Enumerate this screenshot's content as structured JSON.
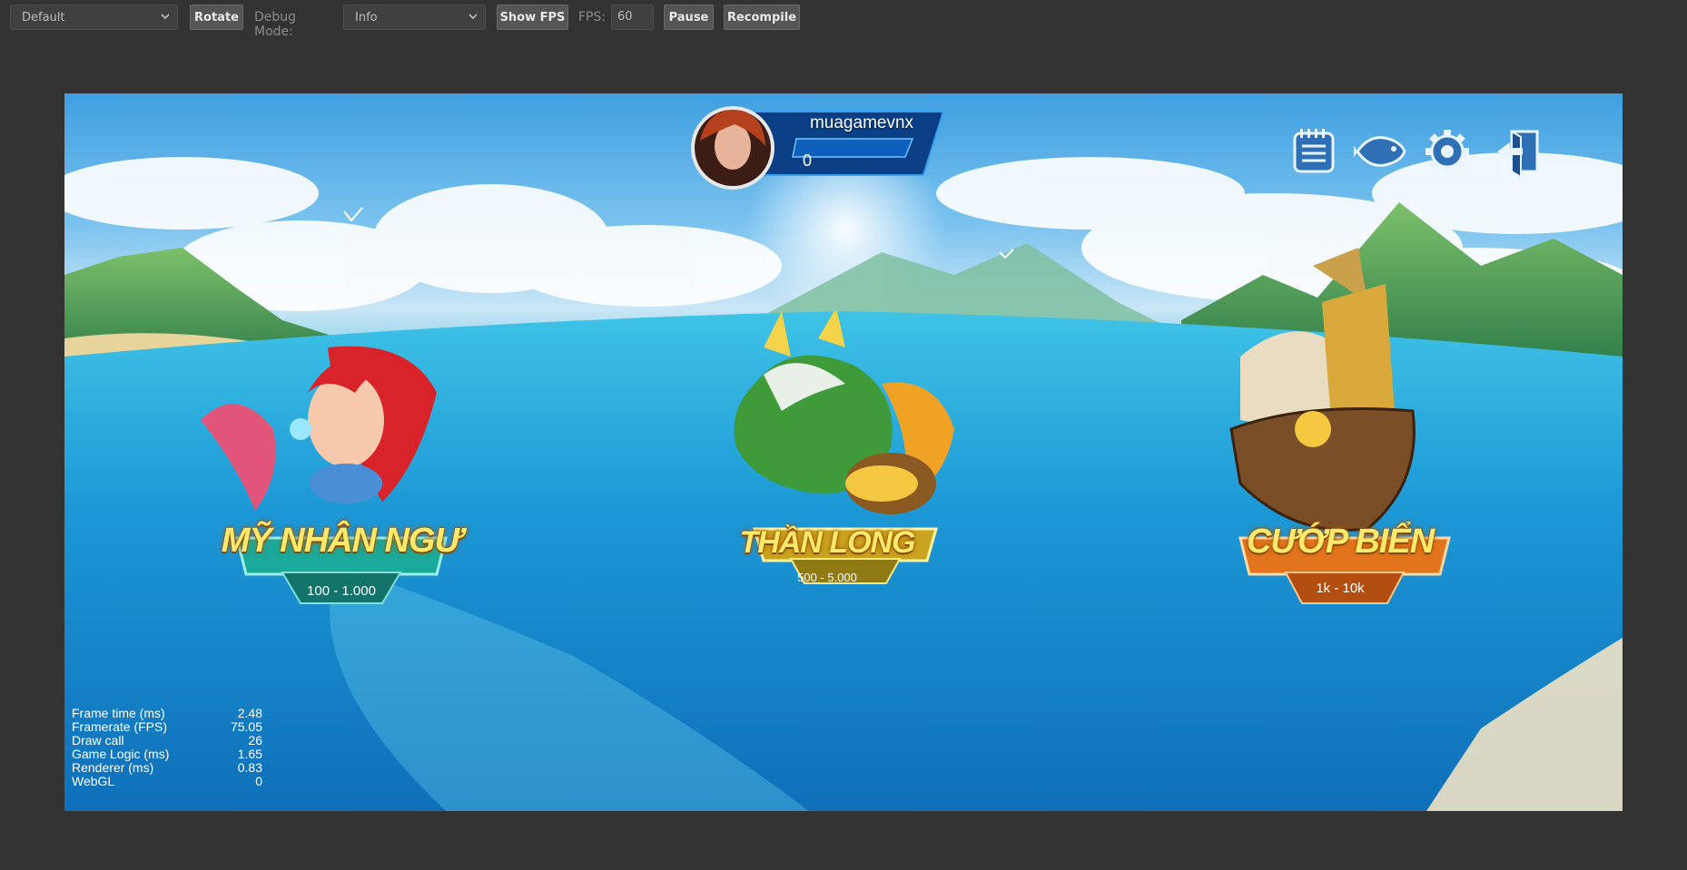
{
  "toolbar": {
    "device_select": "Default",
    "rotate_label": "Rotate",
    "debug_mode_label": "Debug Mode:",
    "debug_mode_select": "Info",
    "show_fps_label": "Show FPS",
    "fps_label": "FPS:",
    "fps_value": "60",
    "pause_label": "Pause",
    "recompile_label": "Recompile"
  },
  "profile": {
    "username": "muagamevnx",
    "balance": "0"
  },
  "top_icons": [
    "notebook-icon",
    "fish-icon",
    "gear-icon",
    "exit-icon"
  ],
  "games": [
    {
      "title": "MỸ NHÂN NGƯ",
      "range": "100 - 1.000",
      "color": "#1aa99a"
    },
    {
      "title": "THẦN LONG",
      "range": "500 - 5.000",
      "color": "#c9a41e"
    },
    {
      "title": "CƯỚP BIỂN",
      "range": "1k - 10k",
      "color": "#e2741d"
    }
  ],
  "stats": [
    {
      "label": "Frame time (ms)",
      "value": "2.48"
    },
    {
      "label": "Framerate (FPS)",
      "value": "75.05"
    },
    {
      "label": "Draw call",
      "value": "26"
    },
    {
      "label": "Game Logic (ms)",
      "value": "1.65"
    },
    {
      "label": "Renderer (ms)",
      "value": "0.83"
    },
    {
      "label": "WebGL",
      "value": "0"
    }
  ]
}
